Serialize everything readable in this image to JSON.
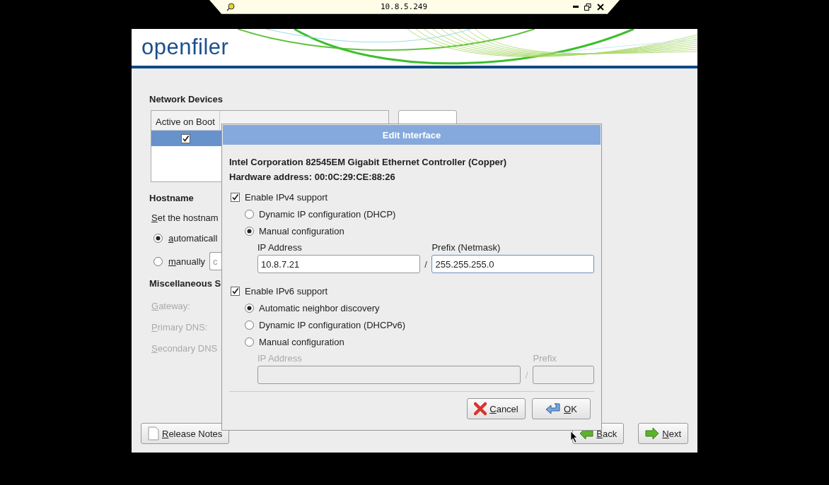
{
  "viewer": {
    "title": "10.8.5.249"
  },
  "installer": {
    "logo": "openfiler",
    "network_devices": {
      "heading": "Network Devices",
      "columns": [
        "Active on Boot"
      ],
      "rows": [
        {
          "active_on_boot": true,
          "selected": true
        }
      ]
    },
    "hostname": {
      "heading": "Hostname",
      "description": "Set the hostnam",
      "options": [
        {
          "label": "automaticall",
          "selected": true
        },
        {
          "label": "manually",
          "selected": false
        }
      ],
      "manual_value": "c"
    },
    "misc": {
      "heading": "Miscellaneous S",
      "fields": [
        {
          "label": "Gateway:",
          "disabled": true
        },
        {
          "label": "Primary DNS:",
          "disabled": true
        },
        {
          "label": "Secondary DNS",
          "disabled": true
        }
      ]
    },
    "buttons": [
      {
        "label": "Release Notes",
        "kind": "notes"
      },
      {
        "label": "Back",
        "kind": "back"
      },
      {
        "label": "Next",
        "kind": "next"
      }
    ]
  },
  "dialog": {
    "title": "Edit Interface",
    "device": "Intel Corporation 82545EM Gigabit Ethernet Controller (Copper)",
    "hardware": "Hardware address: 00:0C:29:CE:88:26",
    "ipv4": {
      "label": "Enable IPv4 support",
      "checked": true,
      "options": [
        {
          "label": "Dynamic IP configuration (DHCP)",
          "selected": false
        },
        {
          "label": "Manual configuration",
          "selected": true
        }
      ],
      "address_label": "IP Address",
      "address": "10.8.7.21",
      "separator": "/",
      "prefix_label": "Prefix (Netmask)",
      "prefix": "255.255.255.0",
      "disabled": false,
      "prefix_focused": true
    },
    "ipv6": {
      "label": "Enable IPv6 support",
      "checked": true,
      "options": [
        {
          "label": "Automatic neighbor discovery",
          "selected": true
        },
        {
          "label": "Dynamic IP configuration (DHCPv6)",
          "selected": false
        },
        {
          "label": "Manual configuration",
          "selected": false
        }
      ],
      "address_label": "IP Address",
      "separator": "/",
      "prefix_label": "Prefix",
      "disabled": true,
      "prefix_focused": false
    },
    "buttons": [
      {
        "label": "Cancel",
        "kind": "cancel"
      },
      {
        "label": "OK",
        "kind": "ok"
      }
    ]
  }
}
